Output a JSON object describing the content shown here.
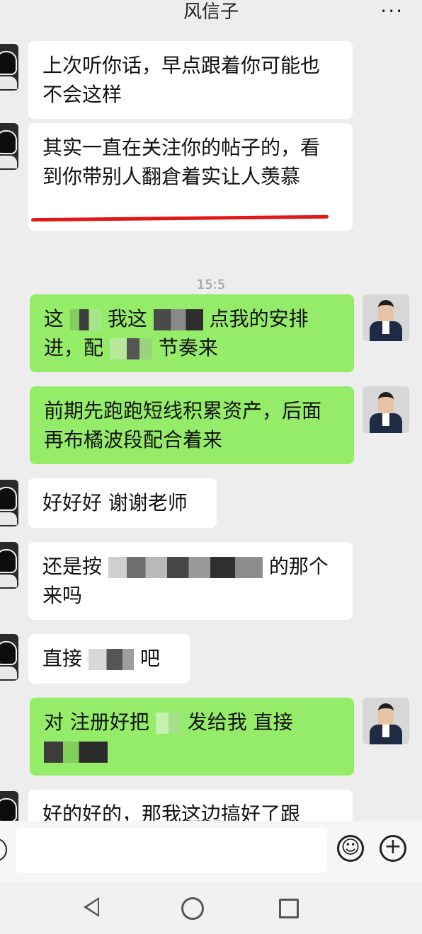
{
  "header": {
    "title": "风信子",
    "more": "···"
  },
  "messages": [
    {
      "side": "left",
      "text": "上次听你话，早点跟着你可能也不会这样"
    },
    {
      "side": "left",
      "text": "其实一直在关注你的帖子的，看到你带别人翻倉着实让人羡慕"
    },
    {
      "type": "time",
      "text": "15:5"
    },
    {
      "side": "right",
      "parts": [
        "这",
        "我这",
        "点我的安排进，配",
        "节奏来"
      ]
    },
    {
      "side": "right",
      "text": "前期先跑跑短线积累资产，后面再布橘波段配合着来"
    },
    {
      "side": "left",
      "text": "好好好 谢谢老师"
    },
    {
      "side": "left",
      "parts": [
        "还是按",
        "的那个来吗"
      ]
    },
    {
      "side": "left",
      "parts": [
        "直接",
        "吧"
      ]
    },
    {
      "side": "right",
      "parts": [
        "对 注册好把",
        "发给我 直接"
      ]
    },
    {
      "side": "left",
      "text": "好的好的，那我这边搞好了跟"
    }
  ],
  "colors": {
    "background": "#ededed",
    "incoming": "#ffffff",
    "outgoing": "#95ec69",
    "highlight": "#e01818"
  },
  "icons": [
    "voice-icon",
    "emoji-icon",
    "plus-icon",
    "nav-back-icon",
    "nav-home-icon",
    "nav-recent-icon"
  ]
}
